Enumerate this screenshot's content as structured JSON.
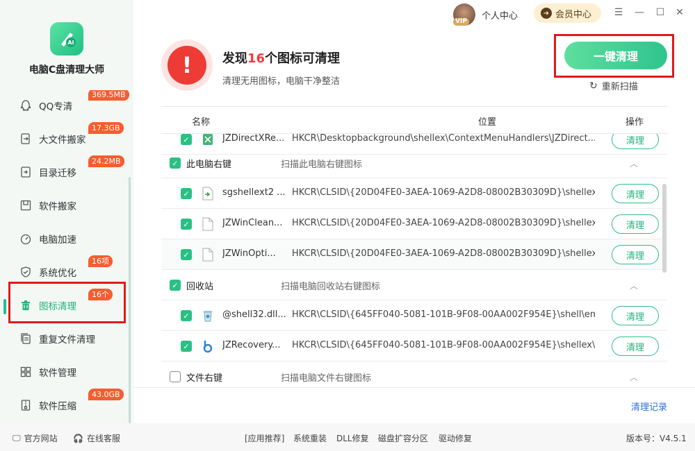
{
  "app": {
    "name": "电脑C盘清理大师"
  },
  "titlebar": {
    "vip": "VIP",
    "personal": "个人中心",
    "member": "会员中心"
  },
  "sidebar": {
    "items": [
      {
        "label": "QQ专清",
        "badge": "369.5MB",
        "icon": "qq-icon"
      },
      {
        "label": "大文件搬家",
        "badge": "17.3GB",
        "icon": "move-file-icon"
      },
      {
        "label": "目录迁移",
        "badge": "24.2MB",
        "icon": "folder-migrate-icon"
      },
      {
        "label": "软件搬家",
        "badge": "",
        "icon": "software-move-icon"
      },
      {
        "label": "电脑加速",
        "badge": "",
        "icon": "speedometer-icon"
      },
      {
        "label": "系统优化",
        "badge": "16项",
        "icon": "shield-icon"
      },
      {
        "label": "图标清理",
        "badge": "16个",
        "icon": "trash-icon"
      },
      {
        "label": "重复文件清理",
        "badge": "",
        "icon": "duplicate-file-icon"
      },
      {
        "label": "软件管理",
        "badge": "",
        "icon": "apps-grid-icon"
      },
      {
        "label": "软件压缩",
        "badge": "43.0GB",
        "icon": "zip-icon"
      }
    ]
  },
  "header": {
    "title_prefix": "发现",
    "count": "16",
    "title_suffix": "个图标可清理",
    "subtitle": "清理无用图标，电脑干净整洁",
    "clean_all": "一键清理",
    "rescan": "重新扫描"
  },
  "table": {
    "columns": {
      "name": "名称",
      "location": "位置",
      "action": "操作"
    },
    "rows": [
      {
        "kind": "item",
        "checked": true,
        "name": "JZDirectXRe...",
        "path": "HKCR\\Desktopbackground\\shellex\\ContextMenuHandlers\\JZDirect...",
        "action": "清理"
      },
      {
        "kind": "group",
        "checked": true,
        "name": "此电脑右键",
        "desc": "扫描此电脑右键图标"
      },
      {
        "kind": "item",
        "checked": true,
        "name": "sgshellext2 ...",
        "path": "HKCR\\CLSID\\{20D04FE0-3AEA-1069-A2D8-08002B30309D}\\shellex\\...",
        "action": "清理"
      },
      {
        "kind": "item",
        "checked": true,
        "name": "JZWinClean...",
        "path": "HKCR\\CLSID\\{20D04FE0-3AEA-1069-A2D8-08002B30309D}\\shellex\\...",
        "action": "清理"
      },
      {
        "kind": "item",
        "checked": true,
        "name": "JZWinOpti...",
        "path": "HKCR\\CLSID\\{20D04FE0-3AEA-1069-A2D8-08002B30309D}\\shellex\\...",
        "action": "清理"
      },
      {
        "kind": "group",
        "checked": true,
        "name": "回收站",
        "desc": "扫描电脑回收站右键图标"
      },
      {
        "kind": "item",
        "checked": true,
        "name": "@shell32.dll...",
        "path": "HKCR\\CLSID\\{645FF040-5081-101B-9F08-00AA002F954E}\\shell\\em...",
        "action": "清理"
      },
      {
        "kind": "item",
        "checked": true,
        "name": "JZRecovery...",
        "path": "HKCR\\CLSID\\{645FF040-5081-101B-9F08-00AA002F954E}\\shellex\\C...",
        "action": "清理"
      },
      {
        "kind": "group",
        "checked": false,
        "name": "文件右键",
        "desc": "扫描电脑文件右键图标"
      }
    ]
  },
  "history": "清理记录",
  "footer": {
    "website": "官方网站",
    "support": "在线客服",
    "links": [
      "[应用推荐]",
      "系统重装",
      "DLL修复",
      "磁盘扩容分区",
      "驱动修复"
    ],
    "version": "版本号：V4.5.1"
  },
  "colors": {
    "accent": "#2bbf85",
    "alert": "#ee3b35",
    "badge": "#f65d2f",
    "highlight_box": "#e01a1a"
  }
}
